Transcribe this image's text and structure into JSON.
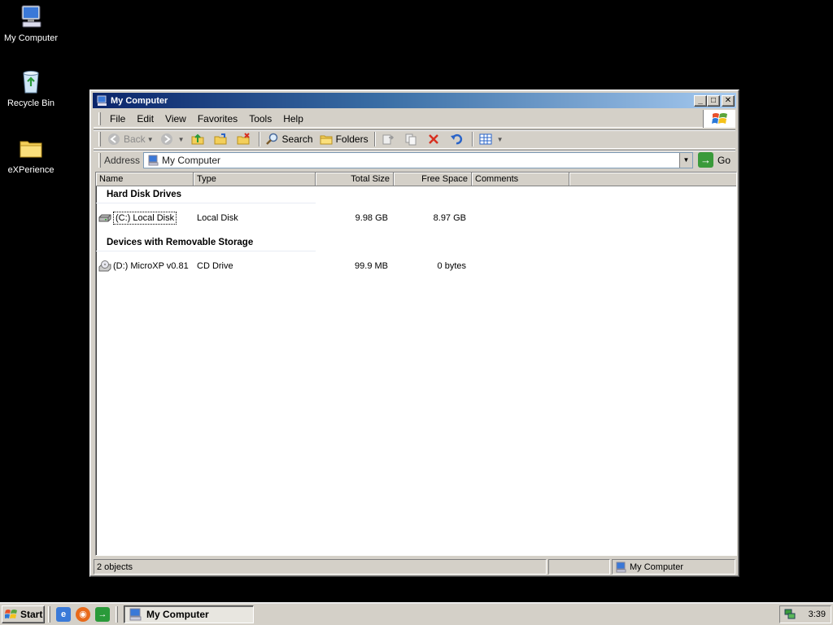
{
  "desktop": {
    "icons": [
      {
        "label": "My Computer",
        "icon": "my-computer-icon"
      },
      {
        "label": "Recycle Bin",
        "icon": "recycle-bin-icon"
      },
      {
        "label": "eXPerience",
        "icon": "folder-icon"
      }
    ]
  },
  "window": {
    "title": "My Computer",
    "menu": [
      "File",
      "Edit",
      "View",
      "Favorites",
      "Tools",
      "Help"
    ],
    "toolbar": {
      "back": "Back",
      "search": "Search",
      "folders": "Folders"
    },
    "address": {
      "label": "Address",
      "value": "My Computer",
      "go": "Go"
    },
    "columns": [
      "Name",
      "Type",
      "Total Size",
      "Free Space",
      "Comments"
    ],
    "groups": [
      {
        "title": "Hard Disk Drives",
        "items": [
          {
            "name": "(C:) Local Disk",
            "type": "Local Disk",
            "total": "9.98 GB",
            "free": "8.97 GB",
            "icon": "hard-disk-icon"
          }
        ]
      },
      {
        "title": "Devices with Removable Storage",
        "items": [
          {
            "name": "(D:) MicroXP v0.81",
            "type": "CD Drive",
            "total": "99.9 MB",
            "free": "0 bytes",
            "icon": "cd-drive-icon"
          }
        ]
      }
    ],
    "status": {
      "objects": "2 objects",
      "location": "My Computer"
    }
  },
  "taskbar": {
    "start": "Start",
    "task": "My Computer",
    "clock": "3:39"
  },
  "colors": {
    "title_active": "#0a246a",
    "title_gradient_end": "#a6caf0",
    "chrome": "#d4d0c8",
    "desktop": "#000000"
  }
}
